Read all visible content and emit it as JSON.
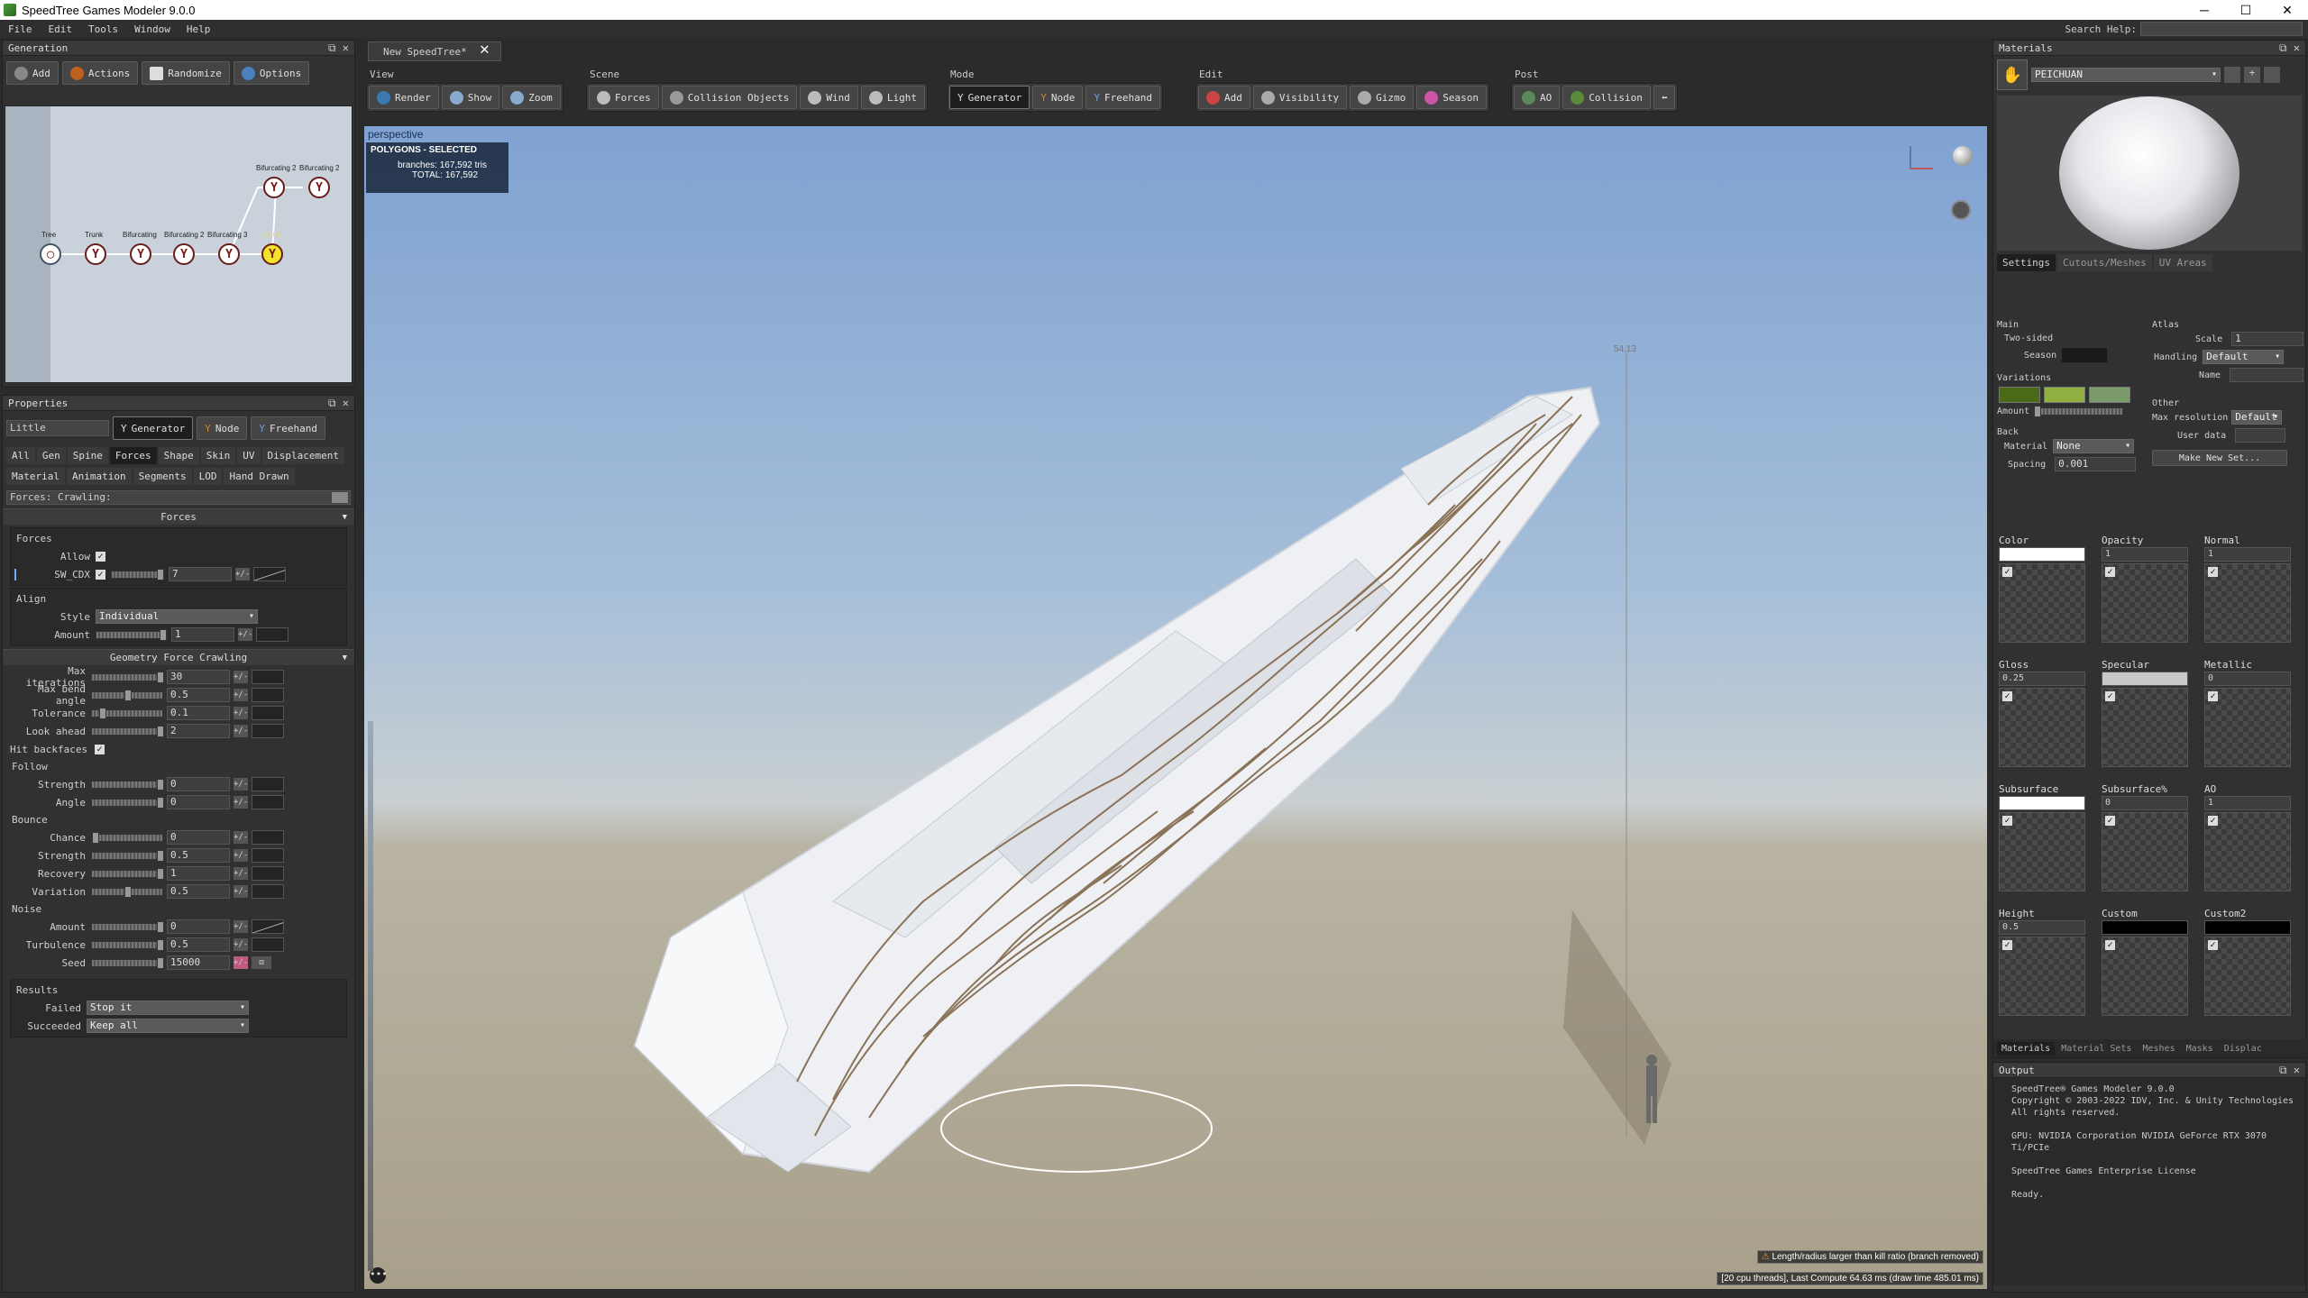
{
  "window": {
    "title": "SpeedTree Games Modeler 9.0.0",
    "minimize": "─",
    "maximize": "☐",
    "close": "✕"
  },
  "menu": [
    "File",
    "Edit",
    "Tools",
    "Window",
    "Help"
  ],
  "search_help": {
    "label": "Search Help:",
    "value": ""
  },
  "generation": {
    "title": "Generation",
    "buttons": [
      "Add",
      "Actions",
      "Randomize",
      "Options"
    ],
    "tree_nodes": [
      "Tree",
      "Trunk",
      "Bifurcating",
      "Bifurcating 2",
      "Bifurcating 3",
      "Little",
      "Bifurcating 2",
      "Bifurcating 2"
    ]
  },
  "properties": {
    "title": "Properties",
    "node_name": "Little",
    "modes": [
      "Generator",
      "Node",
      "Freehand"
    ],
    "tabs_row1": [
      "All",
      "Gen",
      "Spine",
      "Forces",
      "Shape",
      "Skin",
      "UV",
      "Displacement"
    ],
    "tabs_row2": [
      "Material",
      "Animation",
      "Segments",
      "LOD",
      "Hand Drawn"
    ],
    "filter": "Forces: Crawling:",
    "forces_section": "Forces",
    "forces_group": "Forces",
    "allow_label": "Allow",
    "sw_label": "SW_CDX",
    "sw_value": "7",
    "align_group": "Align",
    "style_label": "Style",
    "style_value": "Individual",
    "amount_label": "Amount",
    "amount_value": "1",
    "geo_section": "Geometry Force Crawling",
    "max_iter_label": "Max iterations",
    "max_iter_value": "30",
    "max_bend_label": "Max bend angle",
    "max_bend_value": "0.5",
    "tolerance_label": "Tolerance",
    "tolerance_value": "0.1",
    "look_ahead_label": "Look ahead",
    "look_ahead_value": "2",
    "hit_backfaces_label": "Hit backfaces",
    "follow_group": "Follow",
    "strength_label": "Strength",
    "follow_strength": "0",
    "angle_label": "Angle",
    "follow_angle": "0",
    "bounce_group": "Bounce",
    "chance_label": "Chance",
    "bounce_chance": "0",
    "bounce_strength": "0.5",
    "recovery_label": "Recovery",
    "bounce_recovery": "1",
    "variation_label": "Variation",
    "bounce_variation": "0.5",
    "noise_group": "Noise",
    "noise_amount_label": "Amount",
    "noise_amount": "0",
    "turbulence_label": "Turbulence",
    "noise_turbulence": "0.5",
    "seed_label": "Seed",
    "noise_seed": "15000",
    "results_group": "Results",
    "failed_label": "Failed",
    "failed_value": "Stop it",
    "succeeded_label": "Succeeded",
    "succeeded_value": "Keep all"
  },
  "doc_tab": "New SpeedTree*",
  "toolbar": {
    "view": {
      "label": "View",
      "buttons": [
        "Render",
        "Show",
        "Zoom"
      ]
    },
    "scene": {
      "label": "Scene",
      "buttons": [
        "Forces",
        "Collision Objects",
        "Wind",
        "Light"
      ]
    },
    "mode": {
      "label": "Mode",
      "buttons": [
        "Generator",
        "Node",
        "Freehand"
      ]
    },
    "edit": {
      "label": "Edit",
      "buttons": [
        "Add",
        "Visibility",
        "Gizmo",
        "Season"
      ]
    },
    "post": {
      "label": "Post",
      "buttons": [
        "AO",
        "Collision"
      ]
    }
  },
  "viewport": {
    "camera": "perspective",
    "polygons_title": "POLYGONS - SELECTED",
    "branches_label": "branches:",
    "branches_value": "167,592 tris",
    "total_label": "TOTAL:",
    "total_value": "167,592",
    "height_marker": "54.13",
    "warning": "Length/radius larger than kill ratio (branch removed)",
    "stats": "[20 cpu threads], Last Compute 64.63 ms (draw time 485.01 ms)"
  },
  "materials": {
    "title": "Materials",
    "material_name": "PEICHUAN",
    "tabs": [
      "Settings",
      "Cutouts/Meshes",
      "UV Areas"
    ],
    "main_label": "Main",
    "two_sided_label": "Two-sided",
    "season_label": "Season",
    "variations_label": "Variations",
    "amount_label": "Amount",
    "back_label": "Back",
    "material_label": "Material",
    "material_value": "None",
    "spacing_label": "Spacing",
    "spacing_value": "0.001",
    "atlas_label": "Atlas",
    "scale_label": "Scale",
    "scale_value": "1",
    "handling_label": "Handling",
    "handling_value": "Default",
    "name_label": "Name",
    "other_label": "Other",
    "max_res_label": "Max resolution",
    "max_res_value": "Default",
    "user_data_label": "User data",
    "make_new_set": "Make New Set...",
    "maps": [
      {
        "name": "Color",
        "value": ""
      },
      {
        "name": "Opacity",
        "value": "1"
      },
      {
        "name": "Normal",
        "value": "1"
      },
      {
        "name": "Gloss",
        "value": "0.25"
      },
      {
        "name": "Specular",
        "value": ""
      },
      {
        "name": "Metallic",
        "value": "0"
      },
      {
        "name": "Subsurface",
        "value": ""
      },
      {
        "name": "Subsurface%",
        "value": "0"
      },
      {
        "name": "AO",
        "value": "1"
      },
      {
        "name": "Height",
        "value": "0.5"
      },
      {
        "name": "Custom",
        "value": ""
      },
      {
        "name": "Custom2",
        "value": ""
      }
    ],
    "bottom_tabs": [
      "Materials",
      "Material Sets",
      "Meshes",
      "Masks",
      "Displac"
    ]
  },
  "output": {
    "title": "Output",
    "lines": [
      "SpeedTree® Games Modeler 9.0.0",
      "Copyright © 2003-2022 IDV, Inc. & Unity Technologies",
      "All rights reserved.",
      "",
      "GPU: NVIDIA Corporation NVIDIA GeForce RTX 3070 Ti/PCIe",
      "",
      "SpeedTree Games Enterprise License",
      "",
      "Ready."
    ]
  },
  "colors": {
    "variation1": "#4a6a1a",
    "variation2": "#8fb040",
    "variation3": "#7a9a6a",
    "vine": "#8a7356",
    "hull": "#f2f3f6"
  }
}
